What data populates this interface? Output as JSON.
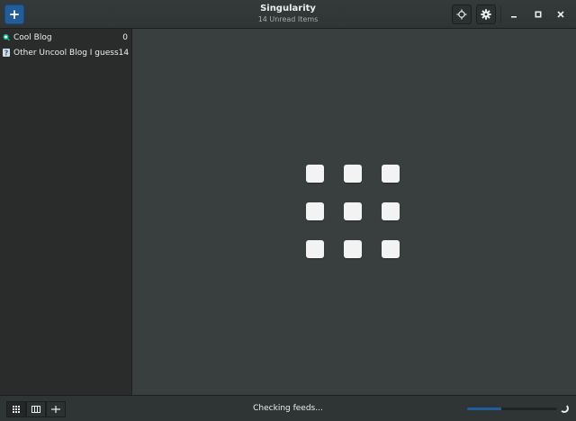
{
  "header": {
    "title": "Singularity",
    "subtitle": "14 Unread Items",
    "add_icon": "plus-icon",
    "locate_icon": "crosshair-icon",
    "settings_icon": "gear-icon"
  },
  "window_controls": [
    "minimize-icon",
    "maximize-icon",
    "close-icon"
  ],
  "sidebar": {
    "feeds": [
      {
        "label": "Cool Blog",
        "count": "0",
        "icon": "feed-icon"
      },
      {
        "label": "Other Uncool Blog I guess",
        "count": "14",
        "icon": "unknown-feed-icon"
      }
    ]
  },
  "main": {
    "view": "tile-grid",
    "tiles": 9
  },
  "footer": {
    "status": "Checking feeds...",
    "progress": 0.38,
    "view_buttons": [
      "grid-view-icon",
      "column-view-icon",
      "split-view-icon"
    ]
  },
  "colors": {
    "accent": "#215d9c",
    "background": "#393f3f",
    "sidebar": "#2a2b2b",
    "text": "#eeeeec"
  }
}
